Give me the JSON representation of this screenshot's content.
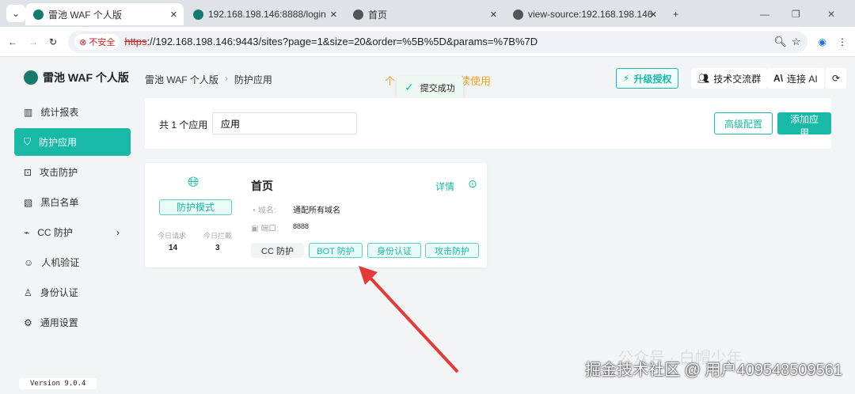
{
  "browser": {
    "tabs": [
      {
        "title": "雷池 WAF 个人版"
      },
      {
        "title": "192.168.198.146:8888/login"
      },
      {
        "title": "首页"
      },
      {
        "title": "view-source:192.168.198.146"
      }
    ],
    "security": "不安全",
    "url_scheme": "https",
    "url_rest": "://192.168.198.146:9443/sites?page=1&size=20&order=%5B%5D&params=%7B%7D"
  },
  "app": {
    "logo": "雷池 WAF 个人版",
    "version": "Version 9.0.4",
    "nav": [
      {
        "label": "统计报表"
      },
      {
        "label": "防护应用"
      },
      {
        "label": "攻击防护"
      },
      {
        "label": "黑白名单"
      },
      {
        "label": "CC 防护"
      },
      {
        "label": "人机验证"
      },
      {
        "label": "身份认证"
      },
      {
        "label": "通用设置"
      }
    ]
  },
  "header": {
    "breadcrumb": [
      "雷池 WAF 个人版",
      "防护应用"
    ],
    "notice_start": "个",
    "notice_end": "续使用",
    "toast": "提交成功",
    "upgrade": "升级授权",
    "community": "技术交流群",
    "ai": "连接 AI"
  },
  "toolbar": {
    "count": "共 1 个应用",
    "search_value": "应用",
    "advanced": "高级配置",
    "add": "添加应用"
  },
  "site": {
    "title": "首页",
    "details": "详情",
    "mode": "防护模式",
    "req_label": "今日请求",
    "req": "14",
    "block_label": "今日拦截",
    "block": "3",
    "domain_label": "域名:",
    "domain": "通配所有域名",
    "port_label": "端口:",
    "port": "8888",
    "tags": [
      "CC 防护",
      "BOT 防护",
      "身份认证",
      "攻击防护"
    ]
  },
  "watermark": {
    "a": "公众号 · 白帽少年",
    "b": "掘金技术社区 @ 用户409548509561"
  },
  "colors": {
    "accent": "#19b9a8"
  }
}
